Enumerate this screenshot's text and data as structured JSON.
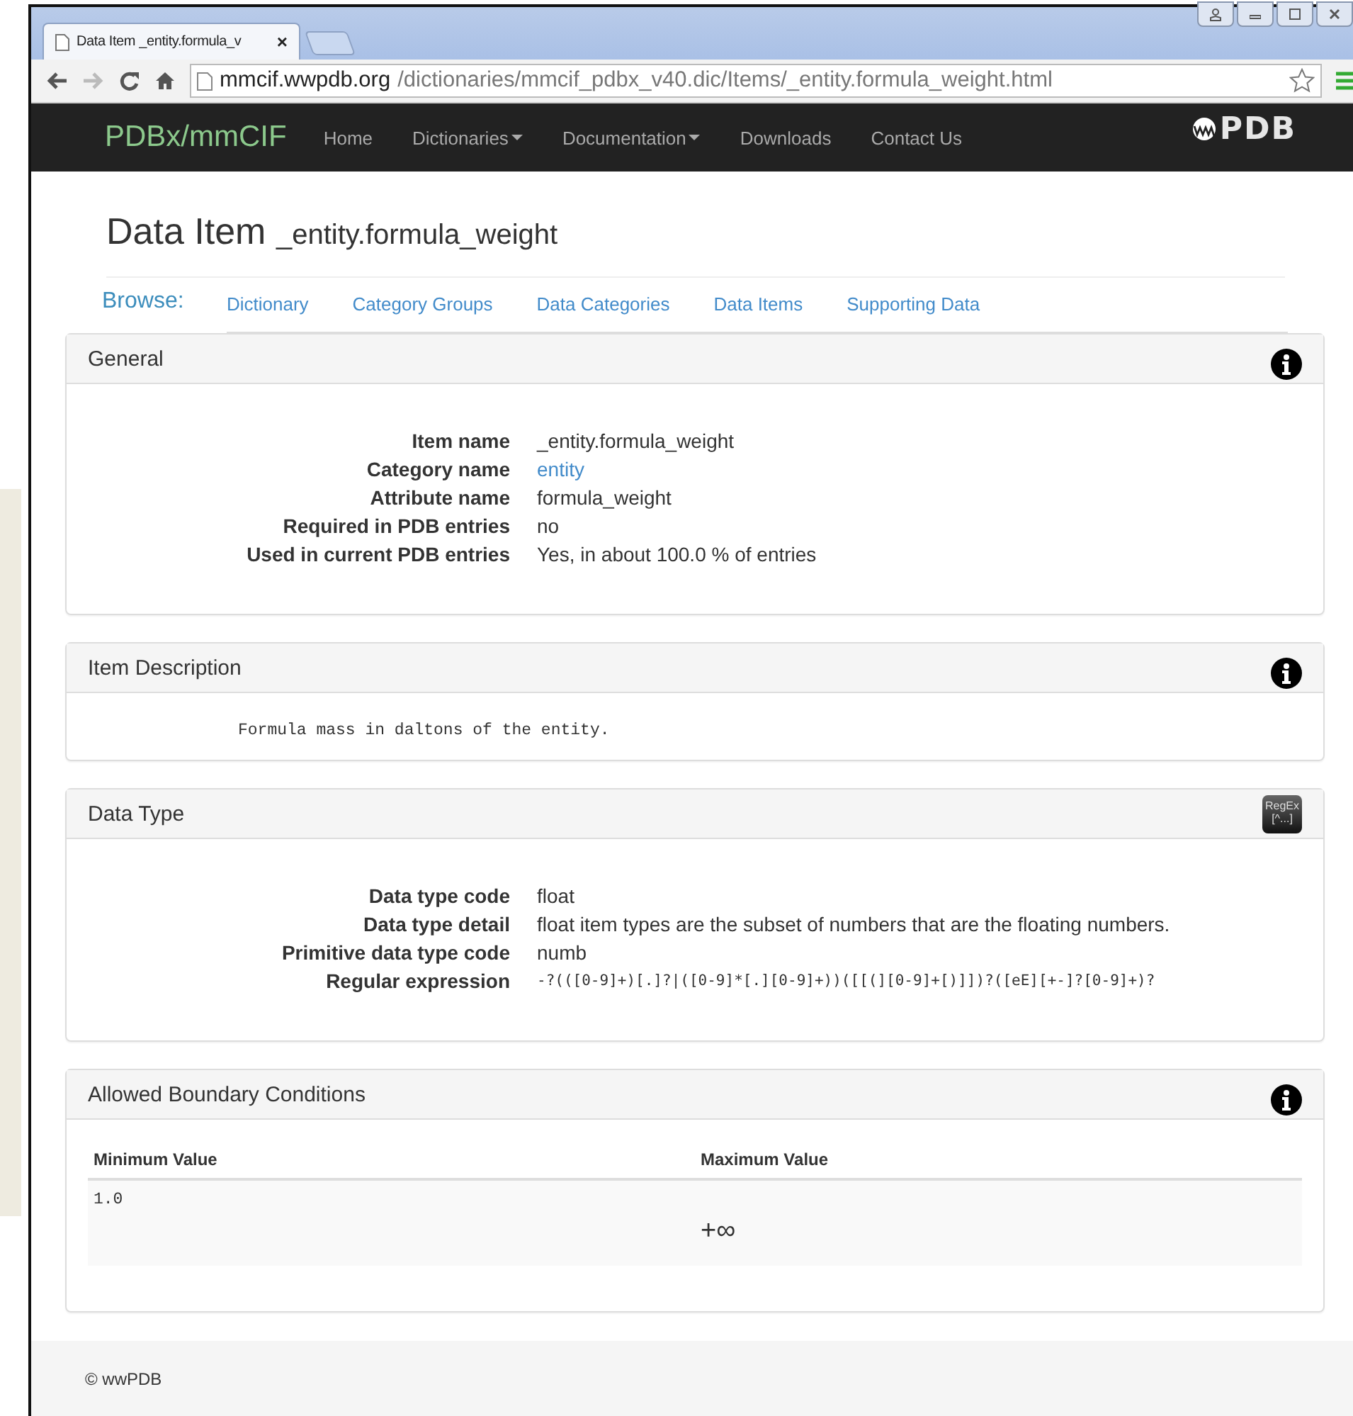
{
  "browser": {
    "tab_title": "Data Item _entity.formula_v",
    "tab_close": "×",
    "url_host": "mmcif.wwpdb.org",
    "url_path": "/dictionaries/mmcif_pdbx_v40.dic/Items/_entity.formula_weight.html"
  },
  "navbar": {
    "brand": "PDBx/mmCIF",
    "logo_text": "PDB",
    "links": [
      {
        "label": "Home",
        "dropdown": false
      },
      {
        "label": "Dictionaries",
        "dropdown": true
      },
      {
        "label": "Documentation",
        "dropdown": true
      },
      {
        "label": "Downloads",
        "dropdown": false
      },
      {
        "label": "Contact Us",
        "dropdown": false
      }
    ]
  },
  "heading": {
    "title": "Data Item",
    "item": "_entity.formula_weight"
  },
  "browse": {
    "label": "Browse:",
    "links": [
      "Dictionary",
      "Category Groups",
      "Data Categories",
      "Data Items",
      "Supporting Data"
    ]
  },
  "general": {
    "title": "General",
    "fields": [
      {
        "label": "Item name",
        "value": "_entity.formula_weight",
        "kind": "text"
      },
      {
        "label": "Category name",
        "value": "entity",
        "kind": "link"
      },
      {
        "label": "Attribute name",
        "value": "formula_weight",
        "kind": "text"
      },
      {
        "label": "Required in PDB entries",
        "value": "no",
        "kind": "text"
      },
      {
        "label": "Used in current PDB entries",
        "value": "Yes, in about 100.0 % of entries",
        "kind": "text"
      }
    ]
  },
  "description": {
    "title": "Item Description",
    "text": "Formula mass in daltons of the entity."
  },
  "data_type": {
    "title": "Data Type",
    "badge_top": "RegEx",
    "badge_bottom": "[^...]",
    "fields": [
      {
        "label": "Data type code",
        "value": "float",
        "kind": "text"
      },
      {
        "label": "Data type detail",
        "value": "float item types are the subset of numbers that are the floating numbers.",
        "kind": "text"
      },
      {
        "label": "Primitive data type code",
        "value": "numb",
        "kind": "text"
      },
      {
        "label": "Regular expression",
        "value": "-?(([0-9]+)[.]?|([0-9]*[.][0-9]+))([[(][0-9]+[)]])?([eE][+-]?[0-9]+)?",
        "kind": "code"
      }
    ]
  },
  "boundary": {
    "title": "Allowed Boundary Conditions",
    "columns": [
      "Minimum Value",
      "Maximum Value"
    ],
    "rows": [
      [
        "1.0",
        "+∞"
      ]
    ]
  },
  "footer": {
    "text": "© wwPDB"
  }
}
